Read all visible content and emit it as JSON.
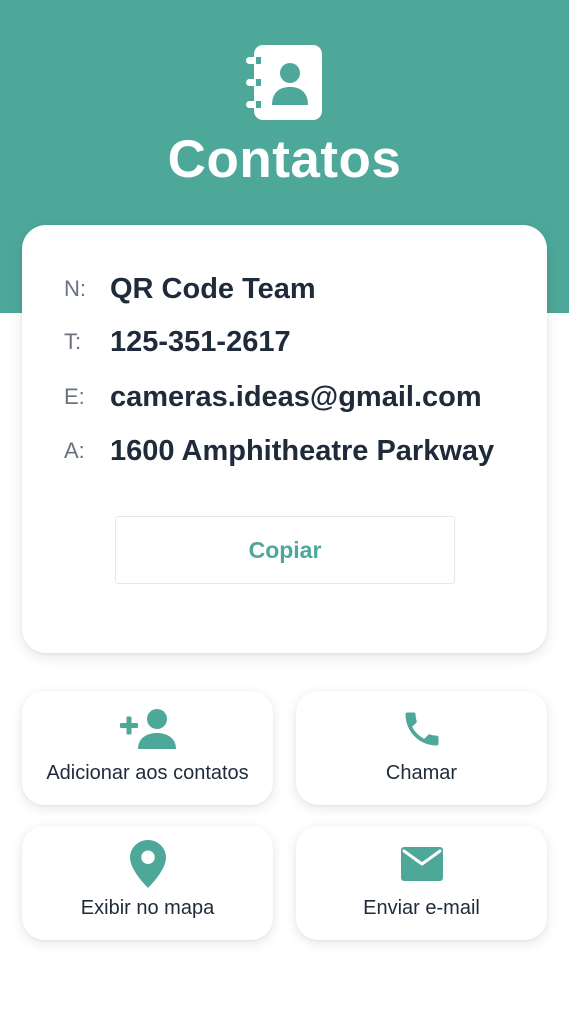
{
  "theme": {
    "accent": "#4ea89a",
    "text": "#1f2a3a",
    "muted": "#6b7280"
  },
  "header": {
    "title": "Contatos",
    "icon": "contact-book-icon"
  },
  "contact": {
    "fields": [
      {
        "key": "N:",
        "value": "QR Code Team"
      },
      {
        "key": "T:",
        "value": "125-351-2617"
      },
      {
        "key": "E:",
        "value": "cameras.ideas@gmail.com"
      },
      {
        "key": "A:",
        "value": "1600 Amphitheatre Parkway"
      }
    ],
    "copy_label": "Copiar"
  },
  "actions": [
    {
      "label": "Adicionar aos contatos",
      "icon": "add-person-icon"
    },
    {
      "label": "Chamar",
      "icon": "phone-icon"
    },
    {
      "label": "Exibir no mapa",
      "icon": "map-pin-icon"
    },
    {
      "label": "Enviar e-mail",
      "icon": "mail-icon"
    }
  ]
}
